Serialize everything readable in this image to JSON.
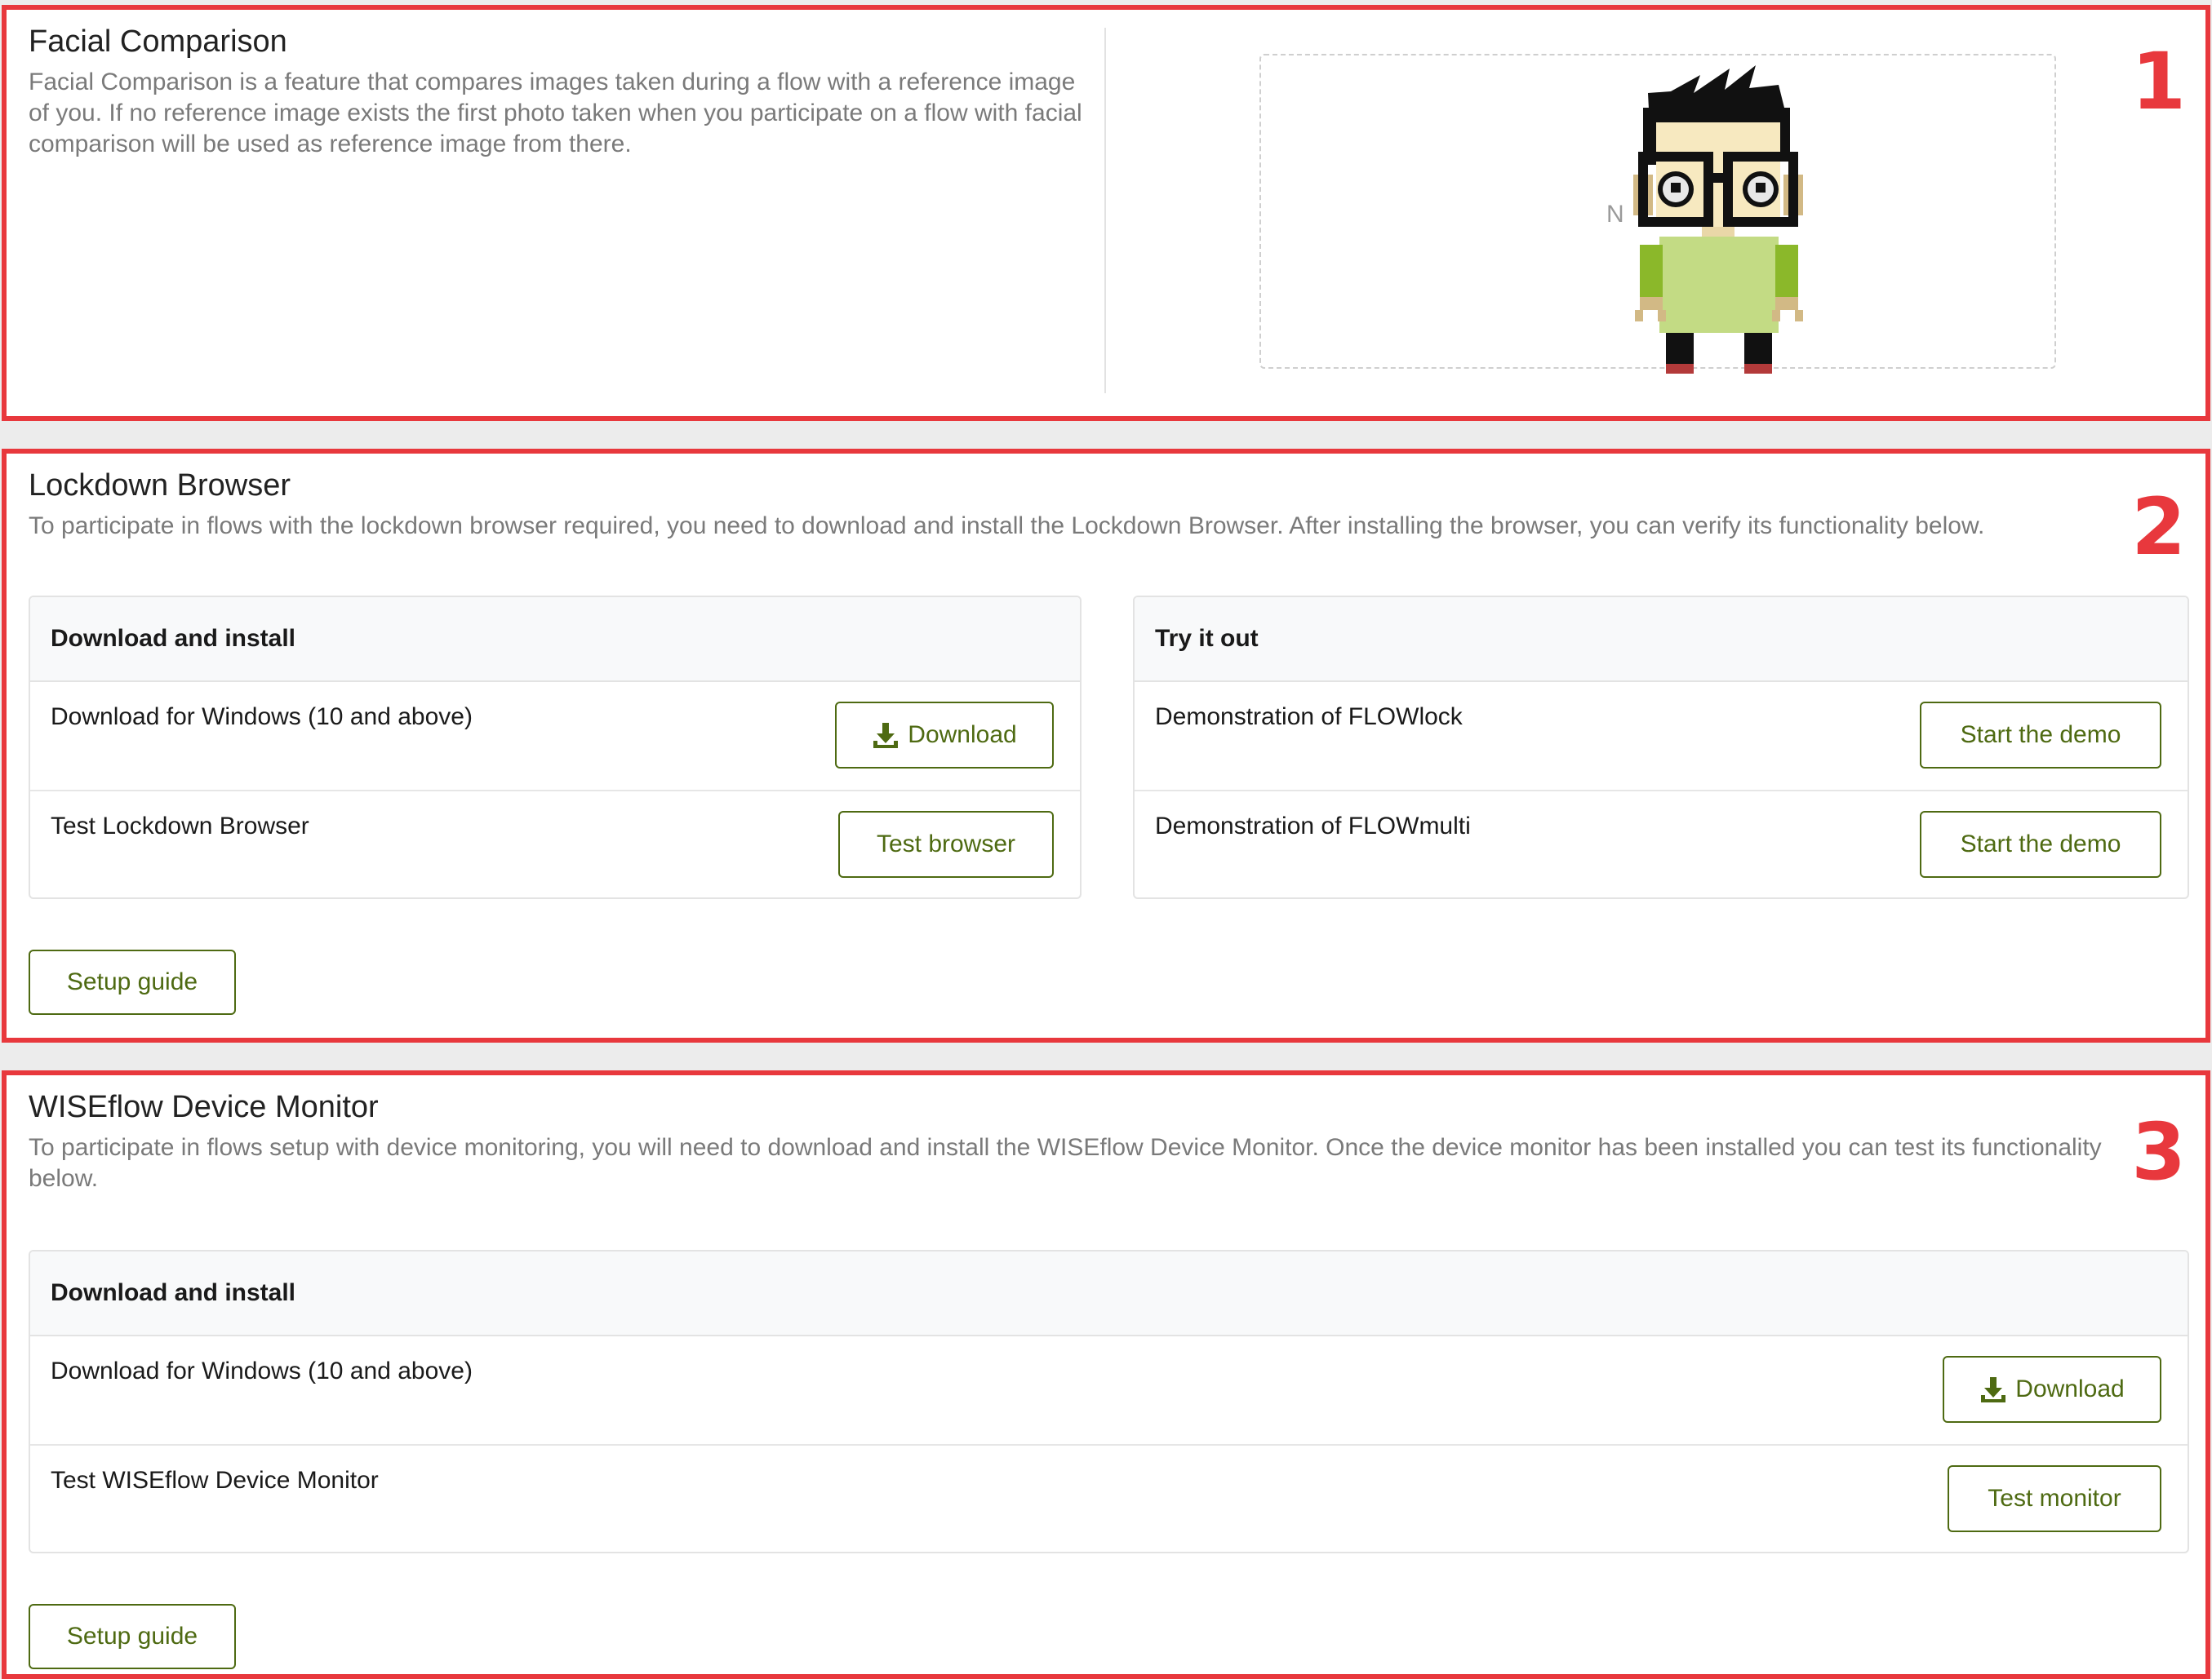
{
  "facial": {
    "title": "Facial Comparison",
    "description": "Facial Comparison is a feature that compares images taken during a flow with a reference image of you. If no reference image exists the first photo taken when you participate on a flow with facial comparison will be used as reference image from there.",
    "dropzone_partial_text": "N",
    "marker": "1"
  },
  "lockdown": {
    "title": "Lockdown Browser",
    "description": "To participate in flows with the lockdown browser required, you need to download and install the Lockdown Browser. After installing the browser, you can verify its functionality below.",
    "marker": "2",
    "install_card": {
      "header": "Download and install",
      "rows": [
        {
          "label": "Download for Windows (10 and above)",
          "button": "Download"
        },
        {
          "label": "Test Lockdown Browser",
          "button": "Test browser"
        }
      ]
    },
    "try_card": {
      "header": "Try it out",
      "rows": [
        {
          "label": "Demonstration of FLOWlock",
          "button": "Start the demo"
        },
        {
          "label": "Demonstration of FLOWmulti",
          "button": "Start the demo"
        }
      ]
    },
    "setup_guide": "Setup guide"
  },
  "monitor": {
    "title": "WISEflow Device Monitor",
    "description": "To participate in flows setup with device monitoring, you will need to download and install the WISEflow Device Monitor. Once the device monitor has been installed you can test its functionality below.",
    "marker": "3",
    "install_card": {
      "header": "Download and install",
      "rows": [
        {
          "label": "Download for Windows (10 and above)",
          "button": "Download"
        },
        {
          "label": "Test WISEflow Device Monitor",
          "button": "Test monitor"
        }
      ]
    },
    "setup_guide": "Setup guide"
  },
  "colors": {
    "accent_green": "#4e6a12",
    "highlight_red": "#e8383d"
  }
}
